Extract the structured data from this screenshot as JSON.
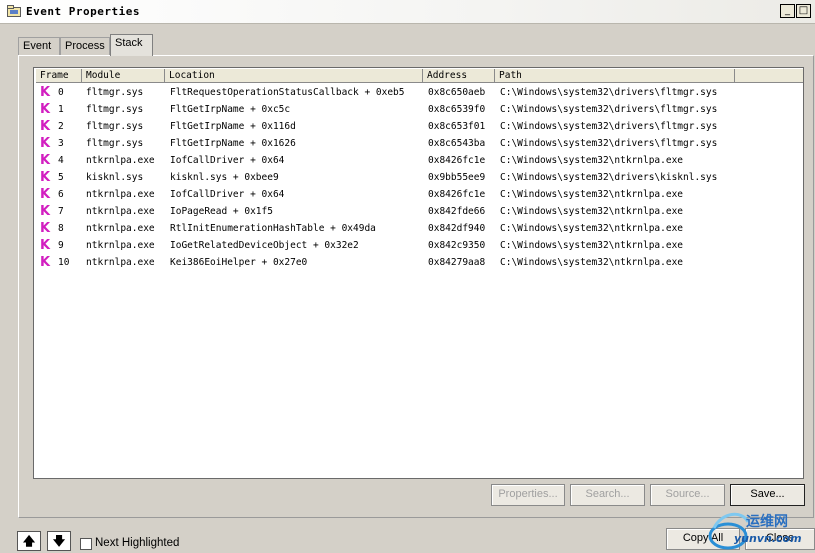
{
  "window": {
    "title": "Event Properties",
    "minimize_glyph": "_",
    "maximize_glyph": "□",
    "app_icon": "folder-window-icon"
  },
  "tabs": [
    {
      "label": "Event",
      "active": false
    },
    {
      "label": "Process",
      "active": false
    },
    {
      "label": "Stack",
      "active": true
    }
  ],
  "columns": [
    "Frame",
    "Module",
    "Location",
    "Address",
    "Path"
  ],
  "frame_icon": {
    "glyph": "K",
    "color": "#d21ec0"
  },
  "rows": [
    {
      "frame": "0",
      "module": "fltmgr.sys",
      "location": "FltRequestOperationStatusCallback + 0xeb5",
      "address": "0x8c650aeb",
      "path": "C:\\Windows\\system32\\drivers\\fltmgr.sys"
    },
    {
      "frame": "1",
      "module": "fltmgr.sys",
      "location": "FltGetIrpName + 0xc5c",
      "address": "0x8c6539f0",
      "path": "C:\\Windows\\system32\\drivers\\fltmgr.sys"
    },
    {
      "frame": "2",
      "module": "fltmgr.sys",
      "location": "FltGetIrpName + 0x116d",
      "address": "0x8c653f01",
      "path": "C:\\Windows\\system32\\drivers\\fltmgr.sys"
    },
    {
      "frame": "3",
      "module": "fltmgr.sys",
      "location": "FltGetIrpName + 0x1626",
      "address": "0x8c6543ba",
      "path": "C:\\Windows\\system32\\drivers\\fltmgr.sys"
    },
    {
      "frame": "4",
      "module": "ntkrnlpa.exe",
      "location": "IofCallDriver + 0x64",
      "address": "0x8426fc1e",
      "path": "C:\\Windows\\system32\\ntkrnlpa.exe"
    },
    {
      "frame": "5",
      "module": "kisknl.sys",
      "location": "kisknl.sys + 0xbee9",
      "address": "0x9bb55ee9",
      "path": "C:\\Windows\\system32\\drivers\\kisknl.sys"
    },
    {
      "frame": "6",
      "module": "ntkrnlpa.exe",
      "location": "IofCallDriver + 0x64",
      "address": "0x8426fc1e",
      "path": "C:\\Windows\\system32\\ntkrnlpa.exe"
    },
    {
      "frame": "7",
      "module": "ntkrnlpa.exe",
      "location": "IoPageRead + 0x1f5",
      "address": "0x842fde66",
      "path": "C:\\Windows\\system32\\ntkrnlpa.exe"
    },
    {
      "frame": "8",
      "module": "ntkrnlpa.exe",
      "location": "RtlInitEnumerationHashTable + 0x49da",
      "address": "0x842df940",
      "path": "C:\\Windows\\system32\\ntkrnlpa.exe"
    },
    {
      "frame": "9",
      "module": "ntkrnlpa.exe",
      "location": "IoGetRelatedDeviceObject + 0x32e2",
      "address": "0x842c9350",
      "path": "C:\\Windows\\system32\\ntkrnlpa.exe"
    },
    {
      "frame": "10",
      "module": "ntkrnlpa.exe",
      "location": "Kei386EoiHelper + 0x27e0",
      "address": "0x84279aa8",
      "path": "C:\\Windows\\system32\\ntkrnlpa.exe"
    }
  ],
  "buttons": {
    "properties": "Properties...",
    "search": "Search...",
    "source": "Source...",
    "save": "Save...",
    "copy_all": "Copy All",
    "close": "Close"
  },
  "nav": {
    "up_glyph": "🡅",
    "down_glyph": "🡇"
  },
  "next_highlighted": {
    "label": "Next Highlighted",
    "checked": false
  },
  "watermark": {
    "line1": "运维网",
    "line2": "yunvn.com"
  }
}
